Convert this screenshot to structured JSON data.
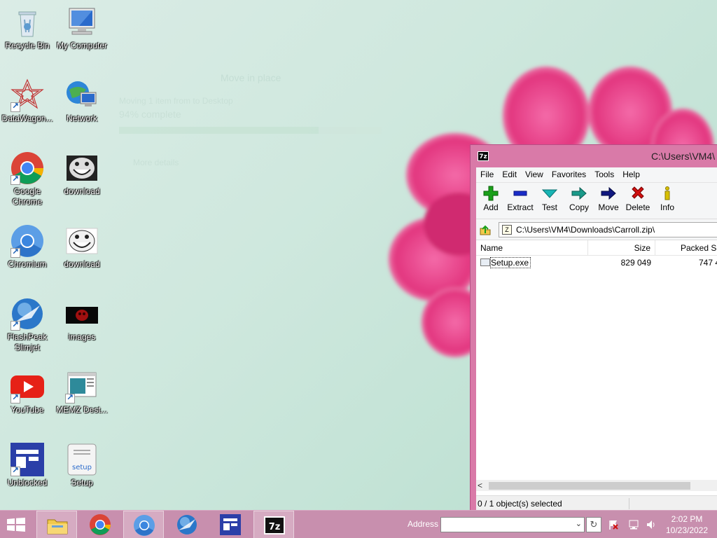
{
  "desktop": {
    "ghost_dialog": {
      "title": "Move in place",
      "line": "Moving 1 item from  to Desktop",
      "progress_text": "94% complete",
      "progress": 0.76,
      "more": "More details"
    },
    "icons": [
      {
        "label": "Recycle Bin"
      },
      {
        "label": "My Computer"
      },
      {
        "label": "DataWagon..."
      },
      {
        "label": "Network"
      },
      {
        "label": "Google Chrome"
      },
      {
        "label": "download"
      },
      {
        "label": "Chromium"
      },
      {
        "label": "download"
      },
      {
        "label": "FlashPeak Slimjet"
      },
      {
        "label": "images"
      },
      {
        "label": "YouTube"
      },
      {
        "label": "MEMZ Dest..."
      },
      {
        "label": "Unblocked"
      },
      {
        "label": "Setup"
      }
    ]
  },
  "sevenzip": {
    "app_icon_text": "7z",
    "title": "C:\\Users\\VM4\\",
    "menu": [
      "File",
      "Edit",
      "View",
      "Favorites",
      "Tools",
      "Help"
    ],
    "toolbar": [
      {
        "label": "Add",
        "icon": "add-icon",
        "color": "#1aa01a"
      },
      {
        "label": "Extract",
        "icon": "extract-icon",
        "color": "#1a2cc8"
      },
      {
        "label": "Test",
        "icon": "test-icon",
        "color": "#18b4b4"
      },
      {
        "label": "Copy",
        "icon": "copy-icon",
        "color": "#1a9a8a"
      },
      {
        "label": "Move",
        "icon": "move-icon",
        "color": "#101880"
      },
      {
        "label": "Delete",
        "icon": "delete-icon",
        "color": "#d01010"
      },
      {
        "label": "Info",
        "icon": "info-icon",
        "color": "#d8c000"
      }
    ],
    "address": "C:\\Users\\VM4\\Downloads\\Carroll.zip\\",
    "columns": [
      "Name",
      "Size",
      "Packed Si"
    ],
    "rows": [
      {
        "name": "Setup.exe",
        "size": "829 049",
        "packed": "747 4"
      }
    ],
    "status": "0 / 1 object(s) selected"
  },
  "taskbar": {
    "address_label": "Address",
    "address_value": "",
    "time": "2:02 PM",
    "date": "10/23/2022",
    "accent": "#c88fae"
  }
}
